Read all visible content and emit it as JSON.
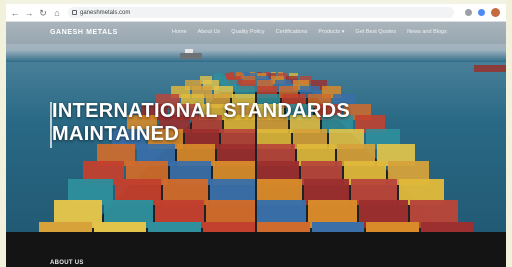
{
  "browser": {
    "url": "ganeshmetals.com"
  },
  "site": {
    "brand": "GANESH METALS",
    "nav": [
      {
        "label": "Home"
      },
      {
        "label": "About Us"
      },
      {
        "label": "Quality Policy"
      },
      {
        "label": "Certifications"
      },
      {
        "label": "Products ▾"
      },
      {
        "label": "Get Best Quotes"
      },
      {
        "label": "News and Blogs"
      }
    ]
  },
  "hero": {
    "title_line1": "INTERNATIONAL STANDARDS",
    "title_line2": "MAINTAINED"
  },
  "about": {
    "heading": "ABOUT US"
  },
  "colors": {
    "sea": "#2a6a86",
    "dark_section": "#141414",
    "frame": "#f2f2dc"
  }
}
